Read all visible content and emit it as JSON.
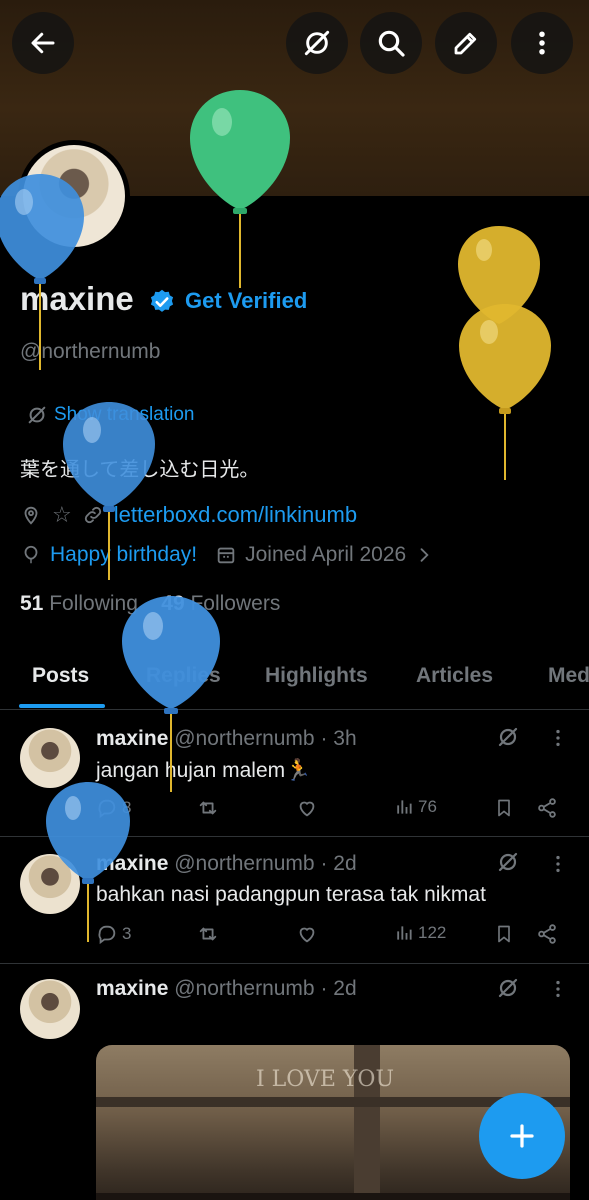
{
  "profile": {
    "name": "maxine",
    "get_verified": "Get Verified",
    "handle": "@northernumb",
    "show_translation": "Show translation",
    "bio": "葉を通して差し込む日光。",
    "location_star": "☆",
    "website": "letterboxd.com/linkinumb",
    "birthday": "Happy birthday!",
    "joined": "Joined April 2026",
    "following_count": "51",
    "following_label": "Following",
    "followers_count": "49",
    "followers_label": "Followers"
  },
  "tabs": [
    "Posts",
    "Replies",
    "Highlights",
    "Articles",
    "Med"
  ],
  "posts": [
    {
      "name": "maxine",
      "meta": "@northernumb · 3h",
      "text": "jangan hujan malem🏃",
      "replies": "8",
      "views": "76"
    },
    {
      "name": "maxine",
      "meta": "@northernumb · 2d",
      "text": "bahkan nasi padangpun terasa tak nikmat",
      "replies": "3",
      "views": "122"
    },
    {
      "name": "maxine",
      "meta": "@northernumb · 2d",
      "media_text": "I LOVE YOU"
    }
  ],
  "colors": {
    "accent": "#1d9bf0",
    "background": "#000000",
    "muted": "#71767b",
    "balloon_green": "#3fc17e",
    "balloon_blue": "#3f8fdd",
    "balloon_yellow": "#e0b72e"
  }
}
